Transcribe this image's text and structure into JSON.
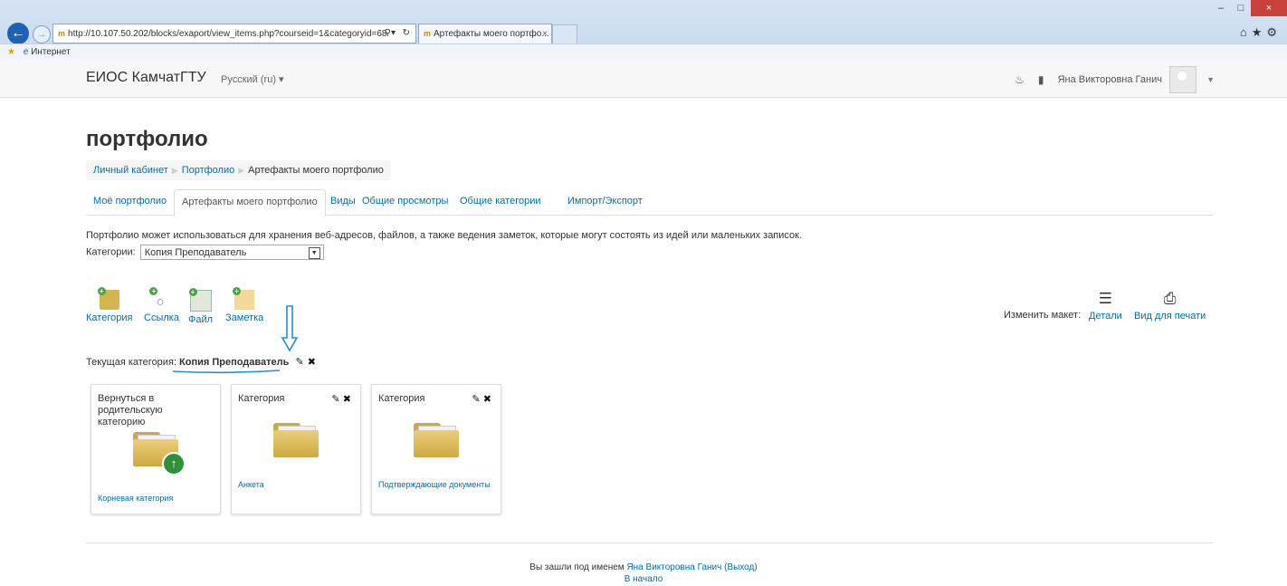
{
  "browser": {
    "url": "http://10.107.50.202/blocks/exaport/view_items.php?courseid=1&categoryid=68",
    "tab_title": "Артефакты моего портфо...",
    "favorites_label": "Интернет"
  },
  "nav": {
    "brand": "ЕИОС КамчатГТУ",
    "language": "Русский (ru) ▾",
    "user_name": "Яна Викторовна Ганич"
  },
  "page": {
    "title": "портфолио",
    "breadcrumb": [
      "Личный кабинет",
      "Портфолио",
      "Артефакты моего портфолио"
    ],
    "tabs": [
      "Моё портфолио",
      "Артефакты моего портфолио",
      "Виды",
      "Общие просмотры",
      "Общие категории",
      "Импорт/Экспорт"
    ],
    "active_tab": "Артефакты моего портфолио",
    "intro": "Портфолио может использоваться для хранения веб-адресов, файлов, а также ведения заметок, которые могут состоять из идей или маленьких записок.",
    "category_label": "Категории:",
    "category_value": "Копия Преподаватель"
  },
  "toolbar": {
    "add_items": [
      {
        "label": "Категория",
        "icon": "folder-add-icon"
      },
      {
        "label": "Ссылка",
        "icon": "link-add-icon"
      },
      {
        "label": "Файл",
        "icon": "file-add-icon"
      },
      {
        "label": "Заметка",
        "icon": "note-add-icon"
      }
    ],
    "layout_label": "Изменить макет:",
    "layout_options": [
      {
        "label": "Детали",
        "icon": "list-icon"
      },
      {
        "label": "Вид для печати",
        "icon": "print-icon"
      }
    ]
  },
  "current": {
    "label": "Текущая категория:",
    "name": "Копия Преподаватель"
  },
  "cards": [
    {
      "title": "Вернуться в родительскую категорию",
      "link": "Корневая категория",
      "editable": false
    },
    {
      "title": "Категория",
      "link": "Анкета",
      "editable": true
    },
    {
      "title": "Категория",
      "link": "Подтверждающие документы",
      "editable": true
    }
  ],
  "footer": {
    "logged_in_prefix": "Вы зашли под именем",
    "user": "Яна Викторовна Ганич",
    "logout": "(Выход)",
    "home": "В начало"
  },
  "colors": {
    "link": "#0070a8",
    "annotation": "#1f8fd6"
  }
}
